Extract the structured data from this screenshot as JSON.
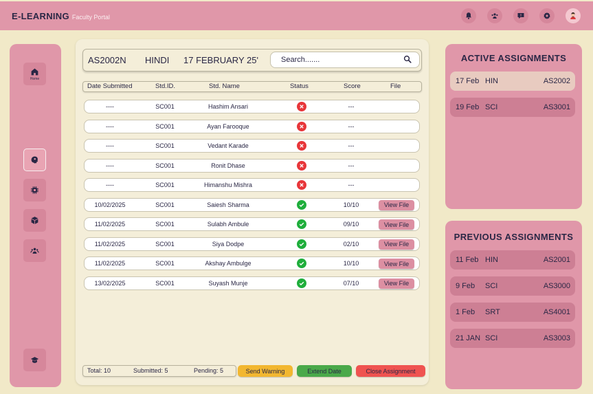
{
  "header": {
    "brand": "E-LEARNING",
    "subtitle": "Faculty Portal",
    "icons": [
      "bell-icon",
      "group-icon",
      "chat-icon",
      "gear-icon",
      "user-avatar"
    ]
  },
  "sidebar": {
    "home_label": "Home",
    "items": [
      "home-icon",
      "brain-icon",
      "chip-icon",
      "cube-icon",
      "group-icon",
      "graduation-cap-icon"
    ]
  },
  "assignment": {
    "code": "AS2002N",
    "subject": "HINDI",
    "date": "17 FEBRUARY 25'"
  },
  "search": {
    "placeholder": "Search......."
  },
  "table": {
    "columns": [
      "Date Submitted",
      "Std.ID.",
      "Std. Name",
      "Status",
      "Score",
      "File"
    ],
    "rows": [
      {
        "date": "----",
        "id": "SC001",
        "name": "Hashim Ansari",
        "status": "not-submitted",
        "score": "---",
        "file": ""
      },
      {
        "date": "----",
        "id": "SC001",
        "name": "Ayan Farooque",
        "status": "not-submitted",
        "score": "---",
        "file": ""
      },
      {
        "date": "----",
        "id": "SC001",
        "name": "Vedant Karade",
        "status": "not-submitted",
        "score": "---",
        "file": ""
      },
      {
        "date": "----",
        "id": "SC001",
        "name": "Ronit Dhase",
        "status": "not-submitted",
        "score": "---",
        "file": ""
      },
      {
        "date": "----",
        "id": "SC001",
        "name": "Himanshu Mishra",
        "status": "not-submitted",
        "score": "---",
        "file": ""
      },
      {
        "date": "10/02/2025",
        "id": "SC001",
        "name": "Saiesh Sharma",
        "status": "submitted",
        "score": "10/10",
        "file": "View File"
      },
      {
        "date": "11/02/2025",
        "id": "SC001",
        "name": "Sulabh Ambule",
        "status": "submitted",
        "score": "09/10",
        "file": "View File"
      },
      {
        "date": "11/02/2025",
        "id": "SC001",
        "name": "Siya Dodpe",
        "status": "submitted",
        "score": "02/10",
        "file": "View File"
      },
      {
        "date": "11/02/2025",
        "id": "SC001",
        "name": "Akshay Ambulge",
        "status": "submitted",
        "score": "10/10",
        "file": "View File"
      },
      {
        "date": "13/02/2025",
        "id": "SC001",
        "name": "Suyash Munje",
        "status": "submitted",
        "score": "07/10",
        "file": "View File"
      }
    ]
  },
  "footer": {
    "total": "Total: 10",
    "submitted": "Submitted: 5",
    "pending": "Pending: 5",
    "send_warning": "Send Warning",
    "extend_date": "Extend Date",
    "close_assignment": "Close Assignment"
  },
  "active_assignments": {
    "title": "ACTIVE ASSIGNMENTS",
    "items": [
      {
        "date": "17 Feb",
        "subject": "HIN",
        "code": "AS2002",
        "selected": true
      },
      {
        "date": "19 Feb",
        "subject": "SCI",
        "code": "AS3001",
        "selected": false
      }
    ]
  },
  "previous_assignments": {
    "title": "PREVIOUS ASSIGNMENTS",
    "items": [
      {
        "date": "11 Feb",
        "subject": "HIN",
        "code": "AS2001"
      },
      {
        "date": "9 Feb",
        "subject": "SCI",
        "code": "AS3000"
      },
      {
        "date": "1 Feb",
        "subject": "SRT",
        "code": "AS4001"
      },
      {
        "date": "21 JAN",
        "subject": "SCI",
        "code": "AS3003"
      }
    ]
  },
  "colors": {
    "accent": "#e097a9",
    "background": "#f1e9c8",
    "panel": "#f4eed9",
    "success": "#1fae3c",
    "error": "#e8363a",
    "warning": "#f2b730",
    "extend": "#4aa94a",
    "close": "#ef5350"
  }
}
